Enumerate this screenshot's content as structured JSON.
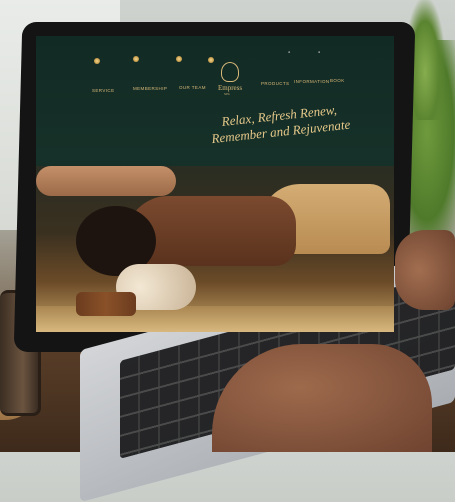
{
  "website": {
    "nav": {
      "left": [
        "SERVICE",
        "MEMBERSHIP",
        "OUR TEAM"
      ],
      "right": [
        "PRODUCTS",
        "INFORMATION",
        "BOOK"
      ]
    },
    "logo": {
      "name": "Empress",
      "tagline": "SPA"
    },
    "hero": {
      "headline_line1": "Relax, Refresh Renew,",
      "headline_line2": "Remember and Rejuvenate"
    }
  },
  "colors": {
    "gold": "#d8b979",
    "dark_green": "#163129"
  }
}
